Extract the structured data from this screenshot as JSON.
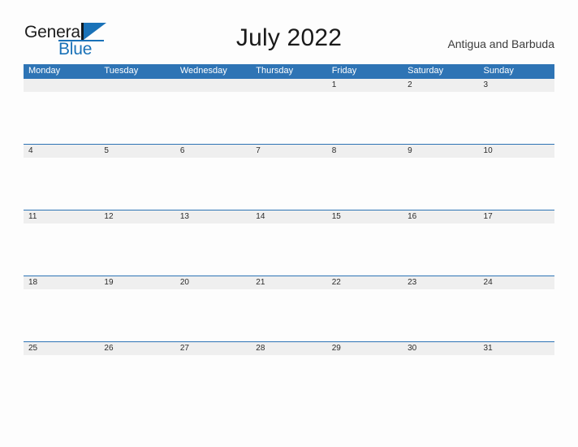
{
  "brand": {
    "name_part1": "General",
    "name_part2": "Blue",
    "logo_icon": "triangle-flag-icon",
    "accent_color": "#1a72b8"
  },
  "header": {
    "title": "July 2022",
    "locale": "Antigua and Barbuda"
  },
  "calendar": {
    "header_color": "#2e74b5",
    "band_color": "#efefef",
    "weekdays": [
      "Monday",
      "Tuesday",
      "Wednesday",
      "Thursday",
      "Friday",
      "Saturday",
      "Sunday"
    ],
    "weeks": [
      [
        "",
        "",
        "",
        "",
        "1",
        "2",
        "3"
      ],
      [
        "4",
        "5",
        "6",
        "7",
        "8",
        "9",
        "10"
      ],
      [
        "11",
        "12",
        "13",
        "14",
        "15",
        "16",
        "17"
      ],
      [
        "18",
        "19",
        "20",
        "21",
        "22",
        "23",
        "24"
      ],
      [
        "25",
        "26",
        "27",
        "28",
        "29",
        "30",
        "31"
      ]
    ]
  }
}
